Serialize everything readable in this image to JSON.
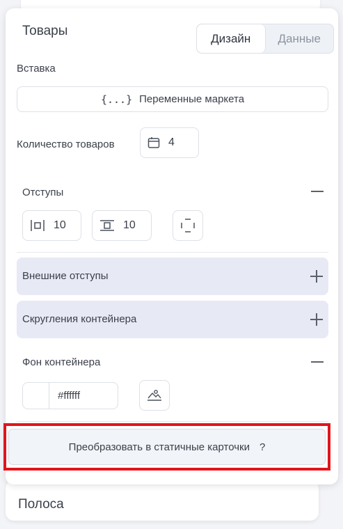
{
  "panel": {
    "title": "Товары",
    "tabs": [
      {
        "label": "Дизайн",
        "active": true
      },
      {
        "label": "Данные",
        "active": false
      }
    ],
    "insert": {
      "label": "Вставка",
      "button_label": "Переменные маркета",
      "button_icon": "{...}"
    },
    "quantity": {
      "label": "Количество товаров",
      "value": "4"
    },
    "padding": {
      "label": "Отступы",
      "horizontal": "10",
      "vertical": "10"
    },
    "outer_margins": {
      "label": "Внешние отступы"
    },
    "container_rounding": {
      "label": "Скругления контейнера"
    },
    "background": {
      "label": "Фон контейнера",
      "color": "#ffffff"
    },
    "convert": {
      "label": "Преобразовать в статичные карточки",
      "help": "?"
    }
  },
  "next_section": {
    "label": "Полоса"
  },
  "colors": {
    "accent_highlight": "#e0161c",
    "accordion_bg": "#e7e9f4"
  }
}
